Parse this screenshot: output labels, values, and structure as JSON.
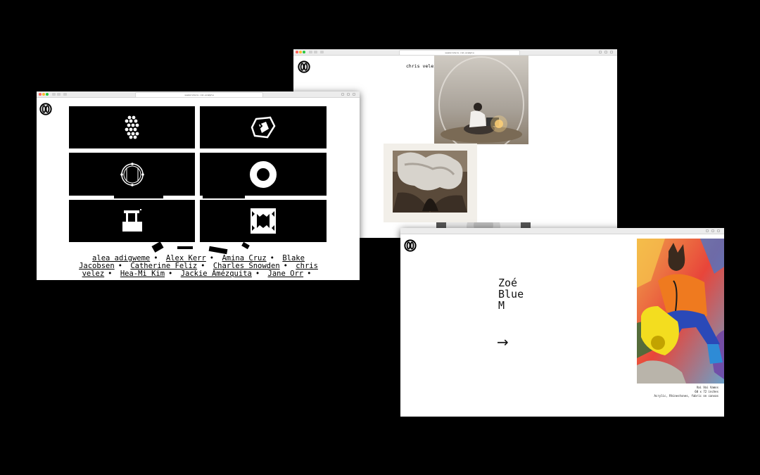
{
  "window_left": {
    "url": "seemorehere.com.example",
    "artist_names": [
      "alea adigweme",
      "Alex Kerr",
      "Amina Cruz",
      "Blake Jacobsen",
      "Catherine Feliz",
      "Charles Snowden",
      "chris velez",
      "Hea-Mi Kim",
      "Jackie Amézquita",
      "Jane Orr"
    ],
    "separator": "•",
    "tile_icons": [
      "glyph-a-icon",
      "glyph-b-icon",
      "circle-outline-icon",
      "ring-icon",
      "frame-icon",
      "notched-square-icon"
    ]
  },
  "window_top": {
    "url": "seemorehere.com.example",
    "artist_heading": "chris velez"
  },
  "window_right": {
    "url": "seemorehere.com.example",
    "artist_title": [
      "Zoé",
      "Blue",
      "M"
    ],
    "arrow": "→",
    "caption": [
      "Vai Vai Vamos",
      "60 x 72 inches",
      "Acrylic, Rhinestones, fabric on canvas"
    ]
  }
}
